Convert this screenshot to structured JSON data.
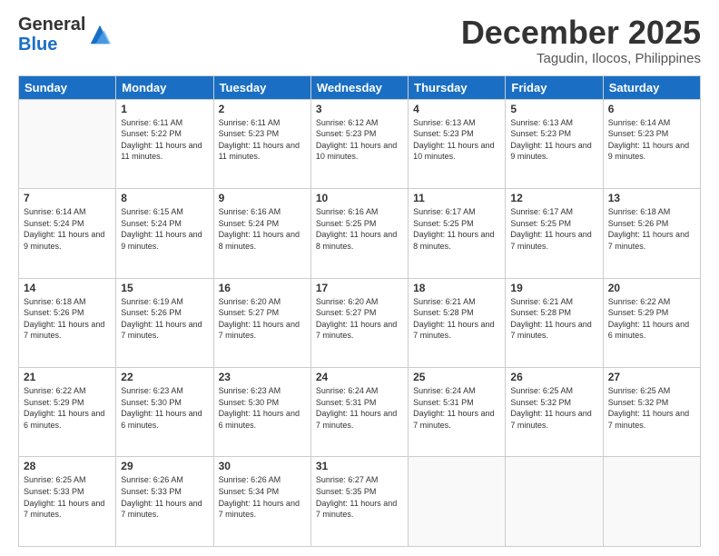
{
  "logo": {
    "general": "General",
    "blue": "Blue"
  },
  "title": "December 2025",
  "location": "Tagudin, Ilocos, Philippines",
  "days_header": [
    "Sunday",
    "Monday",
    "Tuesday",
    "Wednesday",
    "Thursday",
    "Friday",
    "Saturday"
  ],
  "weeks": [
    [
      {
        "day": "",
        "empty": true
      },
      {
        "day": "1",
        "sunrise": "6:11 AM",
        "sunset": "5:22 PM",
        "daylight": "11 hours and 11 minutes."
      },
      {
        "day": "2",
        "sunrise": "6:11 AM",
        "sunset": "5:23 PM",
        "daylight": "11 hours and 11 minutes."
      },
      {
        "day": "3",
        "sunrise": "6:12 AM",
        "sunset": "5:23 PM",
        "daylight": "11 hours and 10 minutes."
      },
      {
        "day": "4",
        "sunrise": "6:13 AM",
        "sunset": "5:23 PM",
        "daylight": "11 hours and 10 minutes."
      },
      {
        "day": "5",
        "sunrise": "6:13 AM",
        "sunset": "5:23 PM",
        "daylight": "11 hours and 9 minutes."
      },
      {
        "day": "6",
        "sunrise": "6:14 AM",
        "sunset": "5:23 PM",
        "daylight": "11 hours and 9 minutes."
      }
    ],
    [
      {
        "day": "7",
        "sunrise": "6:14 AM",
        "sunset": "5:24 PM",
        "daylight": "11 hours and 9 minutes."
      },
      {
        "day": "8",
        "sunrise": "6:15 AM",
        "sunset": "5:24 PM",
        "daylight": "11 hours and 9 minutes."
      },
      {
        "day": "9",
        "sunrise": "6:16 AM",
        "sunset": "5:24 PM",
        "daylight": "11 hours and 8 minutes."
      },
      {
        "day": "10",
        "sunrise": "6:16 AM",
        "sunset": "5:25 PM",
        "daylight": "11 hours and 8 minutes."
      },
      {
        "day": "11",
        "sunrise": "6:17 AM",
        "sunset": "5:25 PM",
        "daylight": "11 hours and 8 minutes."
      },
      {
        "day": "12",
        "sunrise": "6:17 AM",
        "sunset": "5:25 PM",
        "daylight": "11 hours and 7 minutes."
      },
      {
        "day": "13",
        "sunrise": "6:18 AM",
        "sunset": "5:26 PM",
        "daylight": "11 hours and 7 minutes."
      }
    ],
    [
      {
        "day": "14",
        "sunrise": "6:18 AM",
        "sunset": "5:26 PM",
        "daylight": "11 hours and 7 minutes."
      },
      {
        "day": "15",
        "sunrise": "6:19 AM",
        "sunset": "5:26 PM",
        "daylight": "11 hours and 7 minutes."
      },
      {
        "day": "16",
        "sunrise": "6:20 AM",
        "sunset": "5:27 PM",
        "daylight": "11 hours and 7 minutes."
      },
      {
        "day": "17",
        "sunrise": "6:20 AM",
        "sunset": "5:27 PM",
        "daylight": "11 hours and 7 minutes."
      },
      {
        "day": "18",
        "sunrise": "6:21 AM",
        "sunset": "5:28 PM",
        "daylight": "11 hours and 7 minutes."
      },
      {
        "day": "19",
        "sunrise": "6:21 AM",
        "sunset": "5:28 PM",
        "daylight": "11 hours and 7 minutes."
      },
      {
        "day": "20",
        "sunrise": "6:22 AM",
        "sunset": "5:29 PM",
        "daylight": "11 hours and 6 minutes."
      }
    ],
    [
      {
        "day": "21",
        "sunrise": "6:22 AM",
        "sunset": "5:29 PM",
        "daylight": "11 hours and 6 minutes."
      },
      {
        "day": "22",
        "sunrise": "6:23 AM",
        "sunset": "5:30 PM",
        "daylight": "11 hours and 6 minutes."
      },
      {
        "day": "23",
        "sunrise": "6:23 AM",
        "sunset": "5:30 PM",
        "daylight": "11 hours and 6 minutes."
      },
      {
        "day": "24",
        "sunrise": "6:24 AM",
        "sunset": "5:31 PM",
        "daylight": "11 hours and 7 minutes."
      },
      {
        "day": "25",
        "sunrise": "6:24 AM",
        "sunset": "5:31 PM",
        "daylight": "11 hours and 7 minutes."
      },
      {
        "day": "26",
        "sunrise": "6:25 AM",
        "sunset": "5:32 PM",
        "daylight": "11 hours and 7 minutes."
      },
      {
        "day": "27",
        "sunrise": "6:25 AM",
        "sunset": "5:32 PM",
        "daylight": "11 hours and 7 minutes."
      }
    ],
    [
      {
        "day": "28",
        "sunrise": "6:25 AM",
        "sunset": "5:33 PM",
        "daylight": "11 hours and 7 minutes."
      },
      {
        "day": "29",
        "sunrise": "6:26 AM",
        "sunset": "5:33 PM",
        "daylight": "11 hours and 7 minutes."
      },
      {
        "day": "30",
        "sunrise": "6:26 AM",
        "sunset": "5:34 PM",
        "daylight": "11 hours and 7 minutes."
      },
      {
        "day": "31",
        "sunrise": "6:27 AM",
        "sunset": "5:35 PM",
        "daylight": "11 hours and 7 minutes."
      },
      {
        "day": "",
        "empty": true
      },
      {
        "day": "",
        "empty": true
      },
      {
        "day": "",
        "empty": true
      }
    ]
  ]
}
